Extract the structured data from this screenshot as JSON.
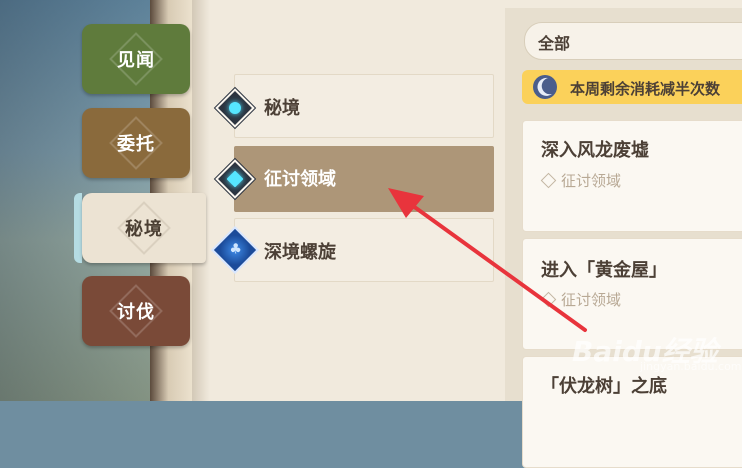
{
  "side_tabs": [
    {
      "label": "见闻",
      "color": "#5f7b3c"
    },
    {
      "label": "委托",
      "color": "#8a6a3c"
    },
    {
      "label": "秘境",
      "color": "#ece3d3",
      "selected": true
    },
    {
      "label": "讨伐",
      "color": "#7a4a38"
    }
  ],
  "menu": {
    "items": [
      {
        "label": "秘境",
        "icon": "domain-diamond-icon"
      },
      {
        "label": "征讨领域",
        "icon": "trounce-domain-diamond-icon",
        "selected": true
      },
      {
        "label": "深境螺旋",
        "icon": "spiral-abyss-tree-icon"
      }
    ]
  },
  "filter": {
    "label": "全部"
  },
  "notice": {
    "text": "本周剩余消耗减半次数",
    "icon": "moon-icon"
  },
  "cards": [
    {
      "title": "深入风龙废墟",
      "subtitle": "征讨领域"
    },
    {
      "title": "进入「黄金屋」",
      "subtitle": "征讨领域"
    },
    {
      "title": "「伏龙树」之底",
      "subtitle": ""
    }
  ],
  "annotation": {
    "type": "red-arrow",
    "color": "#e8343c"
  },
  "watermark": {
    "text": "Baidu经验",
    "sub": "jingyan.baidu.com"
  }
}
